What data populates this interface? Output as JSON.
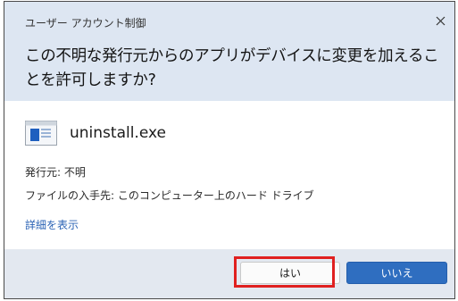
{
  "dialog": {
    "title": "ユーザー アカウント制御",
    "question": "この不明な発行元からのアプリがデバイスに変更を加えることを許可しますか?"
  },
  "app": {
    "name": "uninstall.exe",
    "icon": "executable-file-icon"
  },
  "info": {
    "publisher": "発行元: 不明",
    "source": "ファイルの入手先: このコンピューター上のハード ドライブ"
  },
  "details_link": "詳細を表示",
  "buttons": {
    "yes": "はい",
    "no": "いいえ"
  },
  "colors": {
    "header_bg": "#dde6f2",
    "primary_button": "#2f6ec0",
    "highlight": "#e02020",
    "link": "#2b63b5"
  }
}
